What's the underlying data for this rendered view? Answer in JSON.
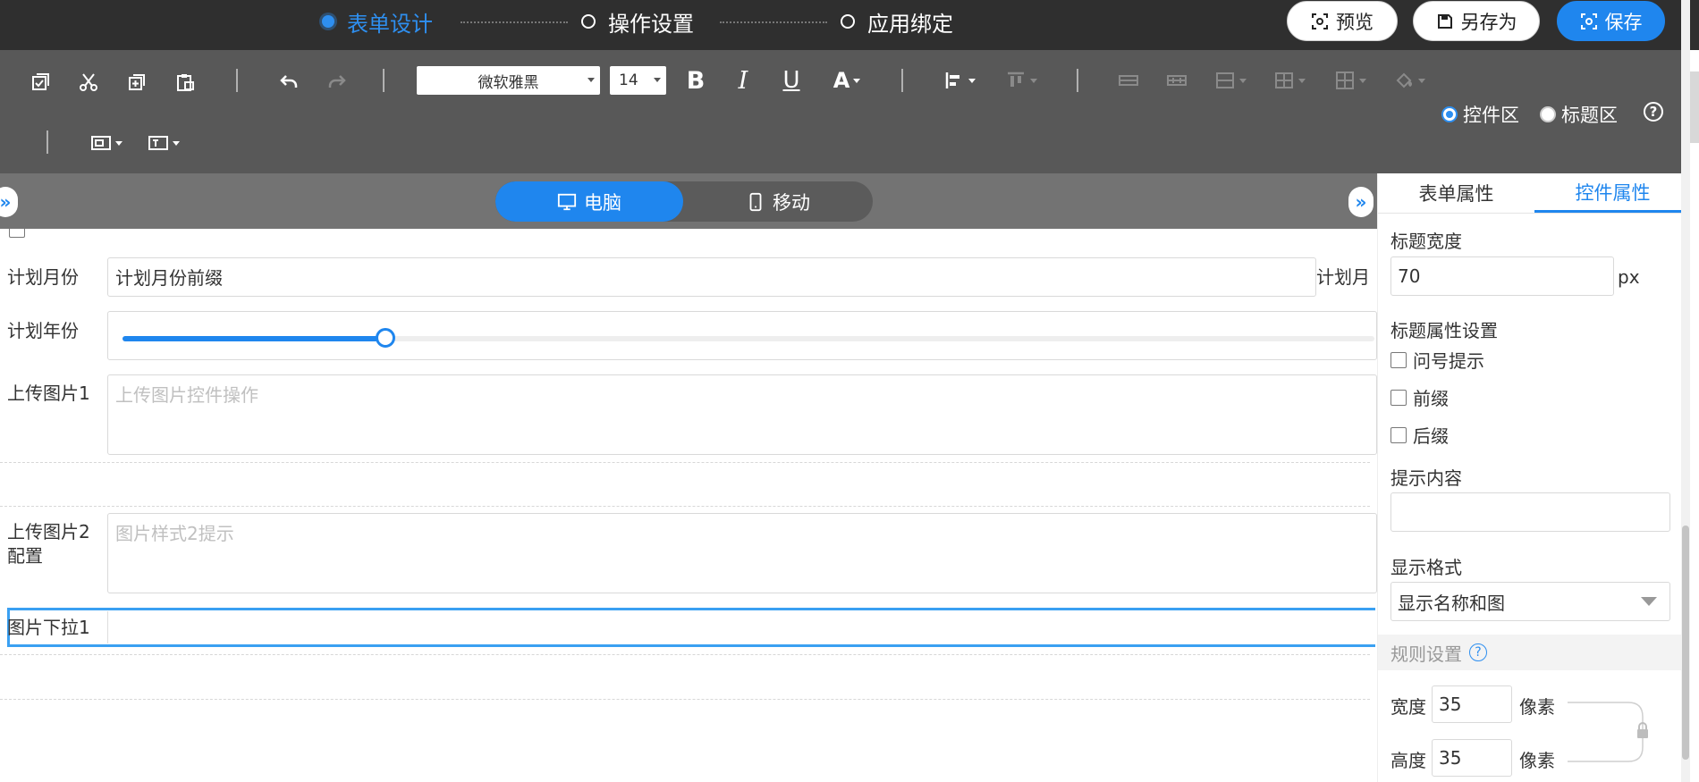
{
  "steps": [
    {
      "label": "表单设计",
      "active": true
    },
    {
      "label": "操作设置",
      "active": false
    },
    {
      "label": "应用绑定",
      "active": false
    }
  ],
  "header_buttons": {
    "preview": "预览",
    "save_as": "另存为",
    "save": "保存"
  },
  "toolbar": {
    "font_family": "微软雅黑",
    "font_size": "14",
    "bold_glyph": "B",
    "italic_glyph": "I",
    "underline_glyph": "U",
    "font_color_glyph": "A",
    "zone_control": "控件区",
    "zone_title": "标题区",
    "help_glyph": "?"
  },
  "device": {
    "pc": "电脑",
    "mobile": "移动"
  },
  "form": {
    "plan_month_label": "计划月份",
    "plan_month_value": "计划月份前缀",
    "plan_month_suffix": "计划月",
    "plan_year_label": "计划年份",
    "plan_year_slider_fraction": 0.21,
    "upload1_label": "上传图片1",
    "upload1_placeholder": "上传图片控件操作",
    "upload2_label_line1": "上传图片2",
    "upload2_label_line2": "配置",
    "upload2_placeholder": "图片样式2提示",
    "dropdown_label": "图片下拉1"
  },
  "panel": {
    "tabs": [
      "表单属性",
      "控件属性"
    ],
    "active_tab": 1,
    "title_width_label": "标题宽度",
    "title_width_value": "70",
    "title_width_unit": "px",
    "title_props_label": "标题属性设置",
    "checkboxes": [
      "问号提示",
      "前缀",
      "后缀"
    ],
    "hint_label": "提示内容",
    "hint_value": "",
    "display_format_label": "显示格式",
    "display_format_value": "显示名称和图",
    "rule_settings_label": "规则设置",
    "width_label": "宽度",
    "width_value": "35",
    "height_label": "高度",
    "height_value": "35",
    "unit": "像素"
  },
  "colors": {
    "accent": "#1f86ee",
    "header_bg": "#2f2f2f",
    "toolbar_bg": "#585858",
    "devbar_bg": "#737373"
  }
}
